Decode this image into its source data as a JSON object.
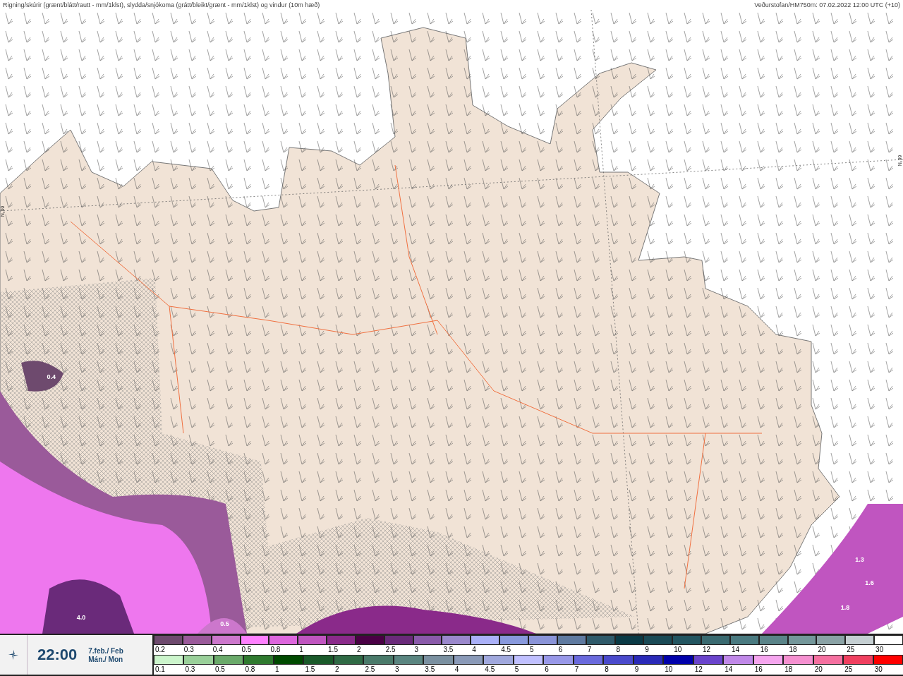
{
  "header": {
    "title": "Rigning/skúrir (grænt/blátt/rautt - mm/1klst), slydda/snjókoma (grátt/bleikt/grænt - mm/1klst) og vindur (10m hæð)",
    "source": "Veðurstofan/HM750m: 07.02.2022 12:00 UTC (+10)"
  },
  "map": {
    "labels": [
      "0.4",
      "4.0",
      "0.5",
      "1.3",
      "1.6",
      "1.8"
    ],
    "latitude_labels": [
      "66°N",
      "66°N"
    ]
  },
  "time_panel": {
    "time": "22:00",
    "date": "7.feb./ Feb",
    "weekday": "Mán./ Mon"
  },
  "legend": {
    "rows": [
      {
        "items": [
          {
            "label": "0.2",
            "color": "#6e4a6e"
          },
          {
            "label": "0.3",
            "color": "#9a5a9a"
          },
          {
            "label": "0.4",
            "color": "#cc77cc"
          },
          {
            "label": "0.5",
            "color": "#ff80ff"
          },
          {
            "label": "0.8",
            "color": "#dd66dd"
          },
          {
            "label": "1",
            "color": "#c055c0"
          },
          {
            "label": "1.5",
            "color": "#8a2a8a"
          },
          {
            "label": "2",
            "color": "#4a0045"
          },
          {
            "label": "2.5",
            "color": "#6a2a7a"
          },
          {
            "label": "3",
            "color": "#8a5aaa"
          },
          {
            "label": "3.5",
            "color": "#9a88cc"
          },
          {
            "label": "4",
            "color": "#aab0f8"
          },
          {
            "label": "4.5",
            "color": "#8899dd"
          },
          {
            "label": "5",
            "color": "#8a94d8"
          },
          {
            "label": "6",
            "color": "#5f7aa0"
          },
          {
            "label": "7",
            "color": "#2f5a6a"
          },
          {
            "label": "8",
            "color": "#0a3a45"
          },
          {
            "label": "9",
            "color": "#1a4a55"
          },
          {
            "label": "10",
            "color": "#235560"
          },
          {
            "label": "12",
            "color": "#3a6a70"
          },
          {
            "label": "14",
            "color": "#4a7a80"
          },
          {
            "label": "16",
            "color": "#5a8488"
          },
          {
            "label": "18",
            "color": "#74979a"
          },
          {
            "label": "20",
            "color": "#8aa2a5"
          },
          {
            "label": "25",
            "color": "#c5cfd2"
          },
          {
            "label": "30",
            "color": "#ffffff"
          }
        ]
      },
      {
        "items": [
          {
            "label": "0.1",
            "color": "#ccf5cc"
          },
          {
            "label": "0.3",
            "color": "#9ad09a"
          },
          {
            "label": "0.5",
            "color": "#6aaa6a"
          },
          {
            "label": "0.8",
            "color": "#2f7a2f"
          },
          {
            "label": "1",
            "color": "#004a00"
          },
          {
            "label": "1.5",
            "color": "#1a5a2a"
          },
          {
            "label": "2",
            "color": "#2f6a45"
          },
          {
            "label": "2.5",
            "color": "#4a7a6a"
          },
          {
            "label": "3",
            "color": "#5a8580"
          },
          {
            "label": "3.5",
            "color": "#7a90a0"
          },
          {
            "label": "4",
            "color": "#8a9ab8"
          },
          {
            "label": "4.5",
            "color": "#a0a8dd"
          },
          {
            "label": "5",
            "color": "#c0c0ff"
          },
          {
            "label": "6",
            "color": "#9898e8"
          },
          {
            "label": "7",
            "color": "#6a6add"
          },
          {
            "label": "8",
            "color": "#4a4acc"
          },
          {
            "label": "9",
            "color": "#2a2ab8"
          },
          {
            "label": "10",
            "color": "#0000aa"
          },
          {
            "label": "12",
            "color": "#6a44cc"
          },
          {
            "label": "14",
            "color": "#c088e8"
          },
          {
            "label": "16",
            "color": "#f5a5ee"
          },
          {
            "label": "18",
            "color": "#f590d0"
          },
          {
            "label": "20",
            "color": "#f570a0"
          },
          {
            "label": "25",
            "color": "#f04060"
          },
          {
            "label": "30",
            "color": "#ff0000"
          }
        ]
      }
    ]
  }
}
